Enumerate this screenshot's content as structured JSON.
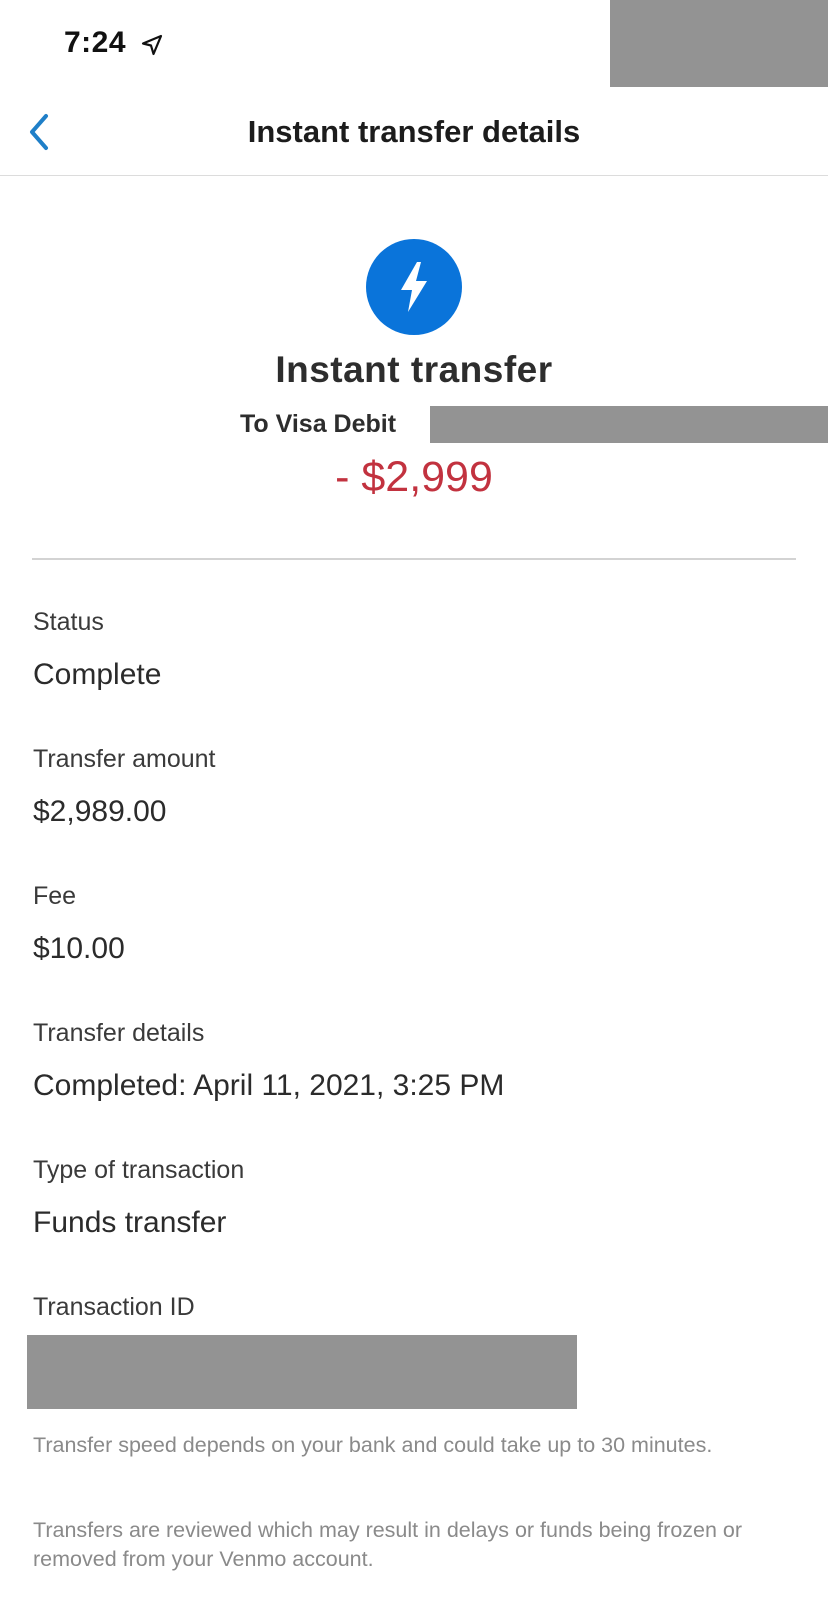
{
  "status_bar": {
    "time": "7:24"
  },
  "nav": {
    "title": "Instant transfer details"
  },
  "header": {
    "title": "Instant transfer",
    "destination": "To Visa Debit",
    "amount": "- $2,999",
    "icon": "lightning-bolt-icon",
    "icon_bg": "#0a74da",
    "amount_color": "#c2323f"
  },
  "details": [
    {
      "label": "Status",
      "value": "Complete"
    },
    {
      "label": "Transfer amount",
      "value": "$2,989.00"
    },
    {
      "label": "Fee",
      "value": "$10.00"
    },
    {
      "label": "Transfer details",
      "value": "Completed: April 11, 2021, 3:25 PM"
    },
    {
      "label": "Type of transaction",
      "value": "Funds transfer"
    },
    {
      "label": "Transaction ID",
      "value": ""
    }
  ],
  "footnotes": [
    "Transfer speed depends on your bank and could take up to 30 minutes.",
    "Transfers are reviewed which may result in delays or funds being frozen or removed from your Venmo account."
  ],
  "colors": {
    "accent": "#1f7fc8",
    "redaction": "#939393"
  }
}
